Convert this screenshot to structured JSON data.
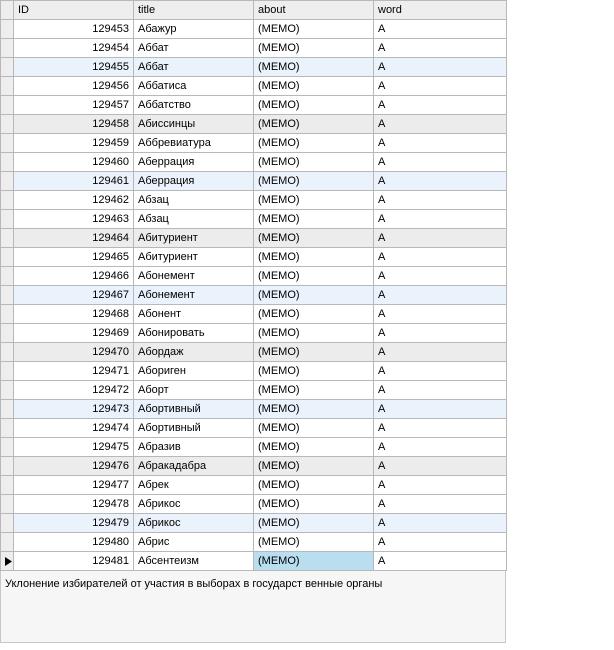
{
  "columns": {
    "id": "ID",
    "title": "title",
    "about": "about",
    "word": "word"
  },
  "rows": [
    {
      "id": "129453",
      "title": "Абажур",
      "about": "(MEMO)",
      "word": "А",
      "cls": "plain"
    },
    {
      "id": "129454",
      "title": "Аббат",
      "about": "(MEMO)",
      "word": "А",
      "cls": "plain"
    },
    {
      "id": "129455",
      "title": "Аббат",
      "about": "(MEMO)",
      "word": "А",
      "cls": "light"
    },
    {
      "id": "129456",
      "title": "Аббатиса",
      "about": "(MEMO)",
      "word": "А",
      "cls": "plain"
    },
    {
      "id": "129457",
      "title": "Аббатство",
      "about": "(MEMO)",
      "word": "А",
      "cls": "plain"
    },
    {
      "id": "129458",
      "title": "Абиссинцы",
      "about": "(MEMO)",
      "word": "А",
      "cls": "gray"
    },
    {
      "id": "129459",
      "title": "Аббревиатура",
      "about": "(MEMO)",
      "word": "А",
      "cls": "plain"
    },
    {
      "id": "129460",
      "title": "Аберрация",
      "about": "(MEMO)",
      "word": "А",
      "cls": "plain"
    },
    {
      "id": "129461",
      "title": "Аберрация",
      "about": "(MEMO)",
      "word": "А",
      "cls": "light"
    },
    {
      "id": "129462",
      "title": "Абзац",
      "about": "(MEMO)",
      "word": "А",
      "cls": "plain"
    },
    {
      "id": "129463",
      "title": "Абзац",
      "about": "(MEMO)",
      "word": "А",
      "cls": "plain"
    },
    {
      "id": "129464",
      "title": "Абитуриент",
      "about": "(MEMO)",
      "word": "А",
      "cls": "gray"
    },
    {
      "id": "129465",
      "title": "Абитуриент",
      "about": "(MEMO)",
      "word": "А",
      "cls": "plain"
    },
    {
      "id": "129466",
      "title": "Абонемент",
      "about": "(MEMO)",
      "word": "А",
      "cls": "plain"
    },
    {
      "id": "129467",
      "title": "Абонемент",
      "about": "(MEMO)",
      "word": "А",
      "cls": "light"
    },
    {
      "id": "129468",
      "title": "Абонент",
      "about": "(MEMO)",
      "word": "А",
      "cls": "plain"
    },
    {
      "id": "129469",
      "title": "Абонировать",
      "about": "(MEMO)",
      "word": "А",
      "cls": "plain"
    },
    {
      "id": "129470",
      "title": "Абордаж",
      "about": "(MEMO)",
      "word": "А",
      "cls": "gray"
    },
    {
      "id": "129471",
      "title": "Абориген",
      "about": "(MEMO)",
      "word": "А",
      "cls": "plain"
    },
    {
      "id": "129472",
      "title": "Аборт",
      "about": "(MEMO)",
      "word": "А",
      "cls": "plain"
    },
    {
      "id": "129473",
      "title": "Абортивный",
      "about": "(MEMO)",
      "word": "А",
      "cls": "light"
    },
    {
      "id": "129474",
      "title": "Абортивный",
      "about": "(MEMO)",
      "word": "А",
      "cls": "plain"
    },
    {
      "id": "129475",
      "title": "Абразив",
      "about": "(MEMO)",
      "word": "А",
      "cls": "plain"
    },
    {
      "id": "129476",
      "title": "Абракадабра",
      "about": "(MEMO)",
      "word": "А",
      "cls": "gray"
    },
    {
      "id": "129477",
      "title": "Абрек",
      "about": "(MEMO)",
      "word": "А",
      "cls": "plain"
    },
    {
      "id": "129478",
      "title": "Абрикос",
      "about": "(MEMO)",
      "word": "А",
      "cls": "plain"
    },
    {
      "id": "129479",
      "title": "Абрикос",
      "about": "(MEMO)",
      "word": "А",
      "cls": "light"
    },
    {
      "id": "129480",
      "title": "Абрис",
      "about": "(MEMO)",
      "word": "А",
      "cls": "plain"
    },
    {
      "id": "129481",
      "title": "Абсентеизм",
      "about": "(MEMO)",
      "word": "А",
      "cls": "plain",
      "current": true,
      "selectedCell": "about"
    }
  ],
  "memoText": "Уклонение избирателей от участия в выборах в государст венные органы"
}
